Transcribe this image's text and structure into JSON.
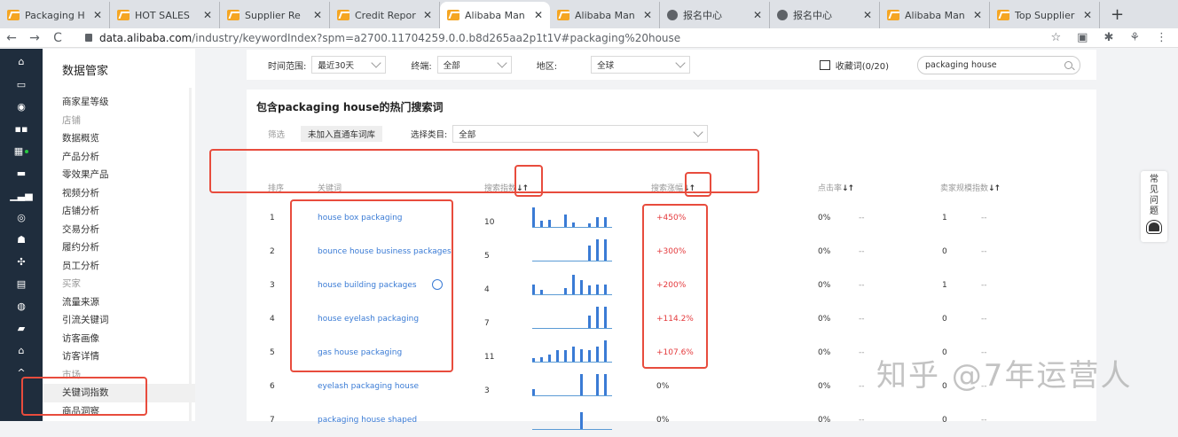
{
  "browser": {
    "tabs": [
      {
        "title": "Packaging H",
        "icon": "alibaba-icon",
        "active": false
      },
      {
        "title": "HOT SALES",
        "icon": "alibaba-icon",
        "active": false
      },
      {
        "title": "Supplier Re",
        "icon": "alibaba-icon",
        "active": false
      },
      {
        "title": "Credit Repor",
        "icon": "alibaba-icon",
        "active": false
      },
      {
        "title": "Alibaba Man",
        "icon": "alibaba-icon",
        "active": true
      },
      {
        "title": "Alibaba Man",
        "icon": "alibaba-icon",
        "active": false
      },
      {
        "title": "报名中心",
        "icon": "globe-icon",
        "active": false
      },
      {
        "title": "报名中心",
        "icon": "globe-icon",
        "active": false
      },
      {
        "title": "Alibaba Man",
        "icon": "alibaba-icon",
        "active": false
      },
      {
        "title": "Top Supplier",
        "icon": "alibaba-icon",
        "active": false
      }
    ],
    "new_tab": "+",
    "url_host": "data.alibaba.com",
    "url_path": "/industry/keywordIndex?spm=a2700.11704259.0.0.b8d265aa2p1t1V#packaging%20house"
  },
  "sidebar": {
    "brand": "数据管家",
    "items": [
      {
        "label": "商家星等级",
        "group": false
      },
      {
        "label": "店铺",
        "group": true
      },
      {
        "label": "数据概览",
        "group": false
      },
      {
        "label": "产品分析",
        "group": false
      },
      {
        "label": "零效果产品",
        "group": false
      },
      {
        "label": "视频分析",
        "group": false
      },
      {
        "label": "店铺分析",
        "group": false
      },
      {
        "label": "交易分析",
        "group": false
      },
      {
        "label": "履约分析",
        "group": false
      },
      {
        "label": "员工分析",
        "group": false
      },
      {
        "label": "买家",
        "group": true
      },
      {
        "label": "流量来源",
        "group": false
      },
      {
        "label": "引流关键词",
        "group": false
      },
      {
        "label": "访客画像",
        "group": false
      },
      {
        "label": "访客详情",
        "group": false
      },
      {
        "label": "市场",
        "group": true
      },
      {
        "label": "关键词指数",
        "group": false,
        "active": true
      },
      {
        "label": "商品洞察",
        "group": false
      }
    ]
  },
  "filters": {
    "time_label": "时间范围:",
    "time_value": "最近30天",
    "terminal_label": "终端:",
    "terminal_value": "全部",
    "region_label": "地区:",
    "region_value": "全球",
    "favorites": "收藏词(0/20)",
    "search_value": "packaging house"
  },
  "card": {
    "title": "包含packaging house的热门搜索词",
    "filter_label": "筛选",
    "tag": "未加入直通车词库",
    "category_label": "选择类目:",
    "category_value": "全部"
  },
  "table": {
    "headers": {
      "rank": "排序",
      "keyword": "关键词",
      "search_index": "搜索指数",
      "search_rise": "搜索涨幅",
      "ctr": "点击率",
      "seller_scale": "卖家规模指数"
    },
    "sort_icon": "↓↑",
    "rows": [
      {
        "rank": "1",
        "keyword": "house box packaging",
        "index": "10",
        "rise": "+450%",
        "ctr": "0%",
        "ctr_trend": "--",
        "seller": "1",
        "seller_trend": "--",
        "spark": [
          0.9,
          0.3,
          0.35,
          0,
          0.6,
          0.2,
          0,
          0.15,
          0.45,
          0.45
        ]
      },
      {
        "rank": "2",
        "keyword": "bounce house business packages",
        "index": "5",
        "rise": "+300%",
        "ctr": "0%",
        "ctr_trend": "--",
        "seller": "0",
        "seller_trend": "--",
        "spark": [
          0,
          0,
          0,
          0,
          0,
          0,
          0,
          0.7,
          1,
          1
        ]
      },
      {
        "rank": "3",
        "keyword": "house building packages",
        "index": "4",
        "rise": "+200%",
        "ctr": "0%",
        "ctr_trend": "--",
        "seller": "1",
        "seller_trend": "--",
        "spark": [
          0.45,
          0.2,
          0,
          0,
          0.3,
          0.9,
          0.65,
          0.4,
          0.45,
          0.45
        ]
      },
      {
        "rank": "4",
        "keyword": "house eyelash packaging",
        "index": "7",
        "rise": "+114.2%",
        "ctr": "0%",
        "ctr_trend": "--",
        "seller": "0",
        "seller_trend": "--",
        "spark": [
          0,
          0,
          0,
          0,
          0,
          0,
          0,
          0.6,
          1,
          1
        ]
      },
      {
        "rank": "5",
        "keyword": "gas house packaging",
        "index": "11",
        "rise": "+107.6%",
        "ctr": "0%",
        "ctr_trend": "--",
        "seller": "0",
        "seller_trend": "--",
        "spark": [
          0.15,
          0.2,
          0.35,
          0.55,
          0.55,
          0.7,
          0.6,
          0.55,
          0.7,
          1
        ]
      },
      {
        "rank": "6",
        "keyword": "eyelash packaging house",
        "index": "3",
        "rise": "0%",
        "ctr": "0%",
        "ctr_trend": "--",
        "seller": "0",
        "seller_trend": "--",
        "spark": [
          0.3,
          0,
          0,
          0,
          0,
          0,
          1,
          0,
          1,
          1
        ]
      },
      {
        "rank": "7",
        "keyword": "packaging house shaped",
        "index": "",
        "rise": "0%",
        "ctr": "0%",
        "ctr_trend": "--",
        "seller": "0",
        "seller_trend": "--",
        "spark": [
          0,
          0,
          0,
          0,
          0,
          0,
          0.8,
          0,
          0,
          0
        ]
      }
    ]
  },
  "help_button": "常见问题",
  "watermark": "知乎 @7年运营人",
  "colors": {
    "accent": "#3a7bd5",
    "rise": "#e4393c",
    "annotation": "#e84c3d",
    "rail": "#1f2d3d"
  }
}
